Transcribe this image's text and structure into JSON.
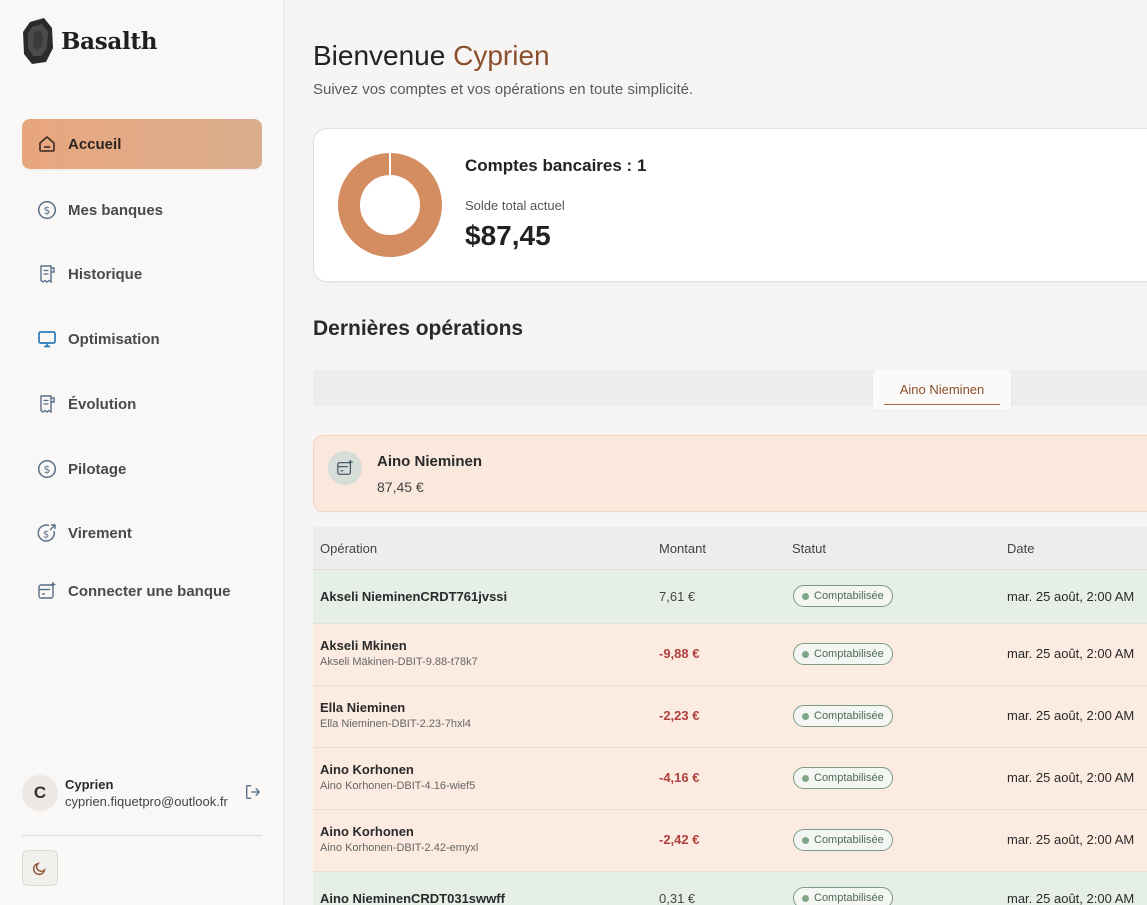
{
  "app": {
    "name": "Basalth"
  },
  "sidebar": {
    "items": [
      {
        "label": "Accueil",
        "icon": "home-icon",
        "active": true
      },
      {
        "label": "Mes banques",
        "icon": "dollar-circle-icon"
      },
      {
        "label": "Historique",
        "icon": "receipt-icon"
      },
      {
        "label": "Optimisation",
        "icon": "monitor-icon"
      },
      {
        "label": "Évolution",
        "icon": "receipt-icon"
      },
      {
        "label": "Pilotage",
        "icon": "dollar-circle-icon"
      },
      {
        "label": "Virement",
        "icon": "dollar-transfer-icon"
      },
      {
        "label": "Connecter une banque",
        "icon": "bank-add-icon"
      }
    ],
    "profile": {
      "initial": "C",
      "name": "Cyprien",
      "email": "cyprien.fiquetpro@outlook.fr"
    }
  },
  "header": {
    "greeting": "Bienvenue",
    "user": "Cyprien",
    "subtitle": "Suivez vos comptes et vos opérations en toute simplicité."
  },
  "balance": {
    "accounts_label": "Comptes bancaires : 1",
    "total_label": "Solde total actuel",
    "total_value": "$87,45",
    "donut_color": "#d38d61"
  },
  "operations": {
    "title": "Dernières opérations",
    "tab": "Aino Nieminen",
    "bank": {
      "name": "Aino Nieminen",
      "amount": "87,45 €"
    },
    "columns": [
      "Opération",
      "Montant",
      "Statut",
      "Date"
    ],
    "rows": [
      {
        "name": "Akseli NieminenCRDT761jvssi",
        "sub": "",
        "amount": "7,61 €",
        "status": "Comptabilisée",
        "date": "mar. 25 août, 2:00 AM",
        "type": "credit"
      },
      {
        "name": "Akseli Mkinen",
        "sub": "Akseli Mäkinen-DBIT-9.88-t78k7",
        "amount": "-9,88 €",
        "status": "Comptabilisée",
        "date": "mar. 25 août, 2:00 AM",
        "type": "debit"
      },
      {
        "name": "Ella Nieminen",
        "sub": "Ella Nieminen-DBIT-2.23-7hxl4",
        "amount": "-2,23 €",
        "status": "Comptabilisée",
        "date": "mar. 25 août, 2:00 AM",
        "type": "debit"
      },
      {
        "name": "Aino Korhonen",
        "sub": "Aino Korhonen-DBIT-4.16-wief5",
        "amount": "-4,16 €",
        "status": "Comptabilisée",
        "date": "mar. 25 août, 2:00 AM",
        "type": "debit"
      },
      {
        "name": "Aino Korhonen",
        "sub": "Aino Korhonen-DBIT-2.42-emyxl",
        "amount": "-2,42 €",
        "status": "Comptabilisée",
        "date": "mar. 25 août, 2:00 AM",
        "type": "debit"
      },
      {
        "name": "Aino NieminenCRDT031swwff",
        "sub": "",
        "amount": "0,31 €",
        "status": "Comptabilisée",
        "date": "mar. 25 août, 2:00 AM",
        "type": "credit"
      }
    ]
  }
}
